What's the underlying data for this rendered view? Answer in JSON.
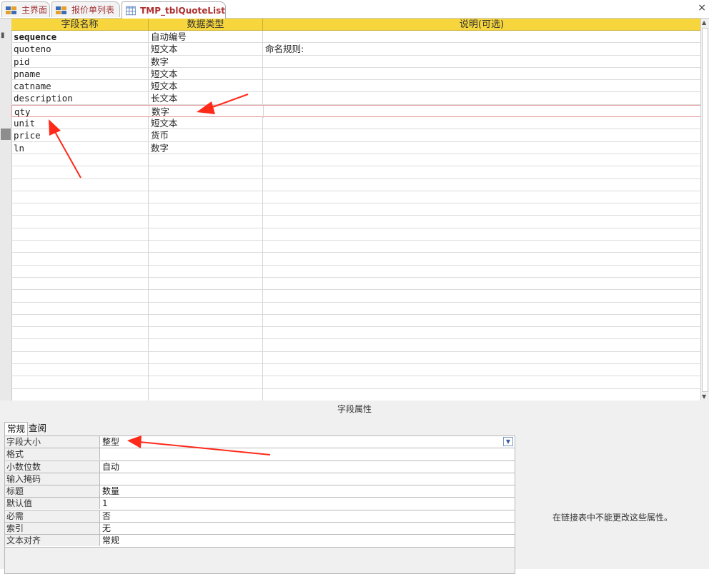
{
  "tabs": [
    {
      "label": "主界面",
      "icon": "form-icon"
    },
    {
      "label": "报价单列表",
      "icon": "form-icon"
    },
    {
      "label": "TMP_tblQuoteList",
      "icon": "table-icon"
    }
  ],
  "close_label": "×",
  "grid": {
    "headers": {
      "field_name": "字段名称",
      "data_type": "数据类型",
      "description": "说明(可选)"
    },
    "rows": [
      {
        "name": "sequence",
        "type": "自动编号",
        "desc": ""
      },
      {
        "name": "quoteno",
        "type": "短文本",
        "desc": "命名规则:"
      },
      {
        "name": "pid",
        "type": "数字",
        "desc": ""
      },
      {
        "name": "pname",
        "type": "短文本",
        "desc": ""
      },
      {
        "name": "catname",
        "type": "短文本",
        "desc": ""
      },
      {
        "name": "description",
        "type": "长文本",
        "desc": ""
      },
      {
        "name": "qty",
        "type": "数字",
        "desc": ""
      },
      {
        "name": "unit",
        "type": "短文本",
        "desc": ""
      },
      {
        "name": "price",
        "type": "货币",
        "desc": ""
      },
      {
        "name": "ln",
        "type": "数字",
        "desc": ""
      }
    ],
    "selected_row": "qty"
  },
  "properties": {
    "title": "字段属性",
    "tabs": [
      "常规",
      "查阅"
    ],
    "rows": [
      {
        "label": "字段大小",
        "value": "整型"
      },
      {
        "label": "格式",
        "value": ""
      },
      {
        "label": "小数位数",
        "value": "自动"
      },
      {
        "label": "输入掩码",
        "value": ""
      },
      {
        "label": "标题",
        "value": "数量"
      },
      {
        "label": "默认值",
        "value": "1"
      },
      {
        "label": "必需",
        "value": "否"
      },
      {
        "label": "索引",
        "value": "无"
      },
      {
        "label": "文本对齐",
        "value": "常规"
      }
    ],
    "hint": "在链接表中不能更改这些属性。"
  },
  "colors": {
    "header": "#f6d63c",
    "tab_text": "#a4373a",
    "annotation": "#ff2a1a"
  }
}
